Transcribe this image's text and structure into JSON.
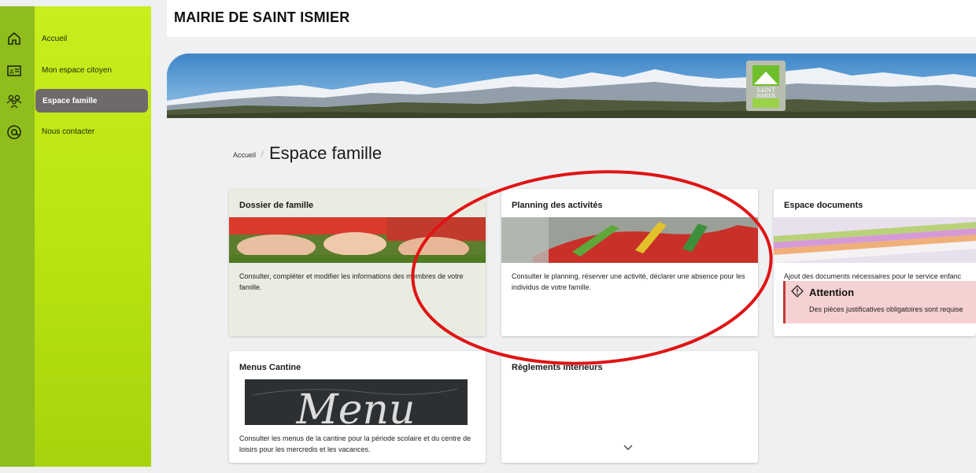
{
  "header": {
    "title": "MAIRIE DE SAINT ISMIER"
  },
  "sidebar": {
    "items": [
      {
        "label": "Accueil",
        "icon": "home-icon"
      },
      {
        "label": "Mon espace citoyen",
        "icon": "id-card-icon"
      },
      {
        "label": "Espace famille",
        "icon": "family-icon",
        "active": true
      },
      {
        "label": "Nous contacter",
        "icon": "at-sign-icon"
      }
    ]
  },
  "banner": {
    "logo_text": [
      "SAINT",
      "ISMIER"
    ]
  },
  "breadcrumb": {
    "home": "Accueil",
    "separator": "/",
    "current": "Espace famille"
  },
  "cards": [
    {
      "title": "Dossier de famille",
      "description": "Consulter, compléter et modifier les informations des membres de votre famille."
    },
    {
      "title": "Planning des activités",
      "description": "Consulter le planning, réserver une activité, déclarer une absence pour les individus de votre famille."
    },
    {
      "title": "Espace documents",
      "description": "Ajout des documents nécessaires pour le service enfanc",
      "alert": {
        "title": "Attention",
        "text": "Des pièces justificatives obligatoires sont requise"
      }
    },
    {
      "title": "Menus Cantine",
      "image_text": "Menu",
      "description": "Consulter les menus de la cantine pour la période scolaire et du centre de loisirs pour les mercredis et les vacances."
    },
    {
      "title": "Règlements intérieurs"
    }
  ],
  "colors": {
    "rail": "#8fbd1e",
    "sidebar": "#c9ee1d",
    "active_item": "#6e6a6a",
    "alert_bg": "#f6d1d1",
    "alert_border": "#c33b3b",
    "annotation": "#e01414"
  }
}
